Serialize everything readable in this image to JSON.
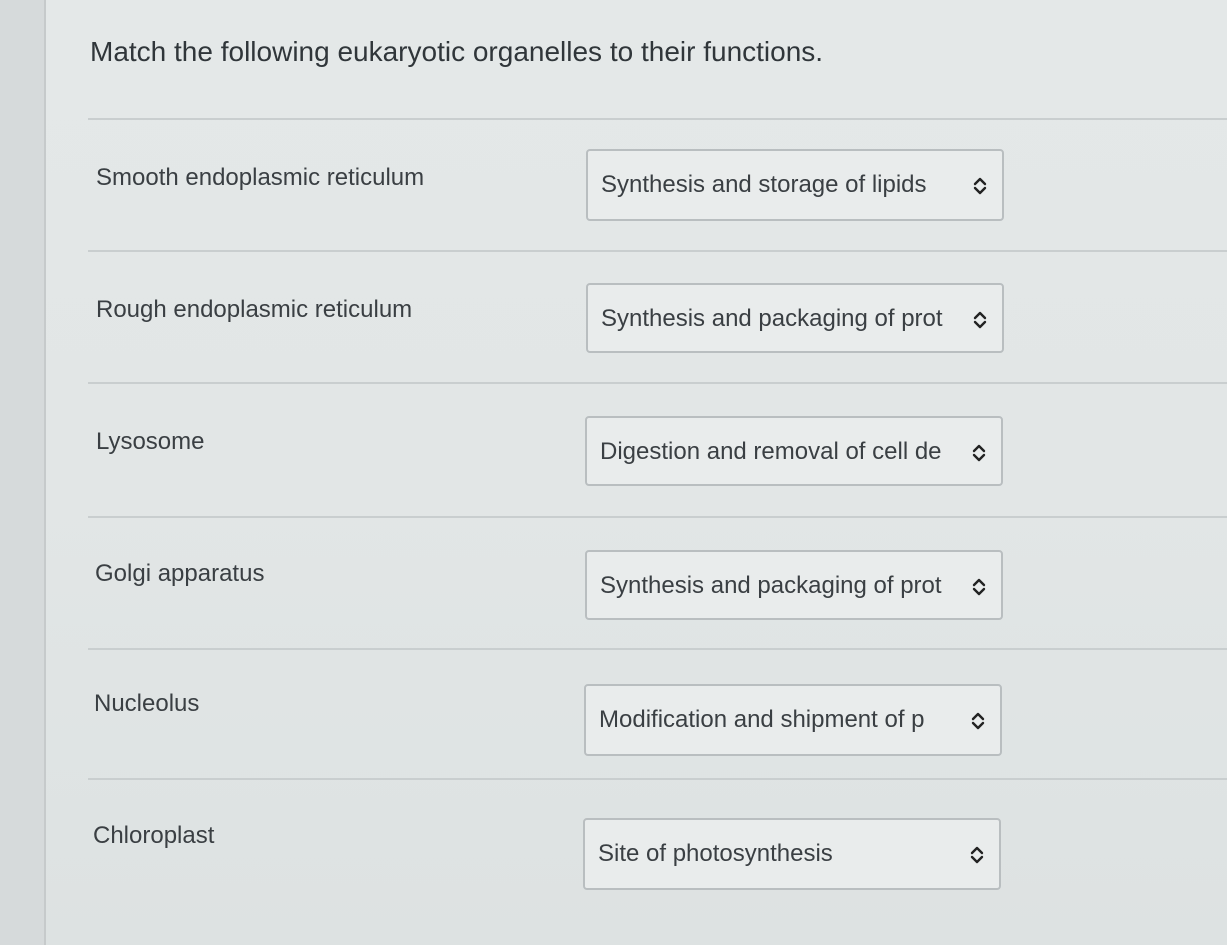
{
  "question": "Match the following eukaryotic organelles to their functions.",
  "rows": [
    {
      "term": "Smooth endoplasmic reticulum",
      "selected": "Synthesis and storage of lipids"
    },
    {
      "term": "Rough endoplasmic reticulum",
      "selected": "Synthesis and packaging of prot"
    },
    {
      "term": "Lysosome",
      "selected": "Digestion and removal of cell de"
    },
    {
      "term": "Golgi apparatus",
      "selected": "Synthesis and packaging of prot"
    },
    {
      "term": "Nucleolus",
      "selected": "Modification and shipment of p"
    },
    {
      "term": "Chloroplast",
      "selected": "Site of photosynthesis"
    }
  ],
  "icons": {
    "select": "chevron-up-down-icon"
  }
}
